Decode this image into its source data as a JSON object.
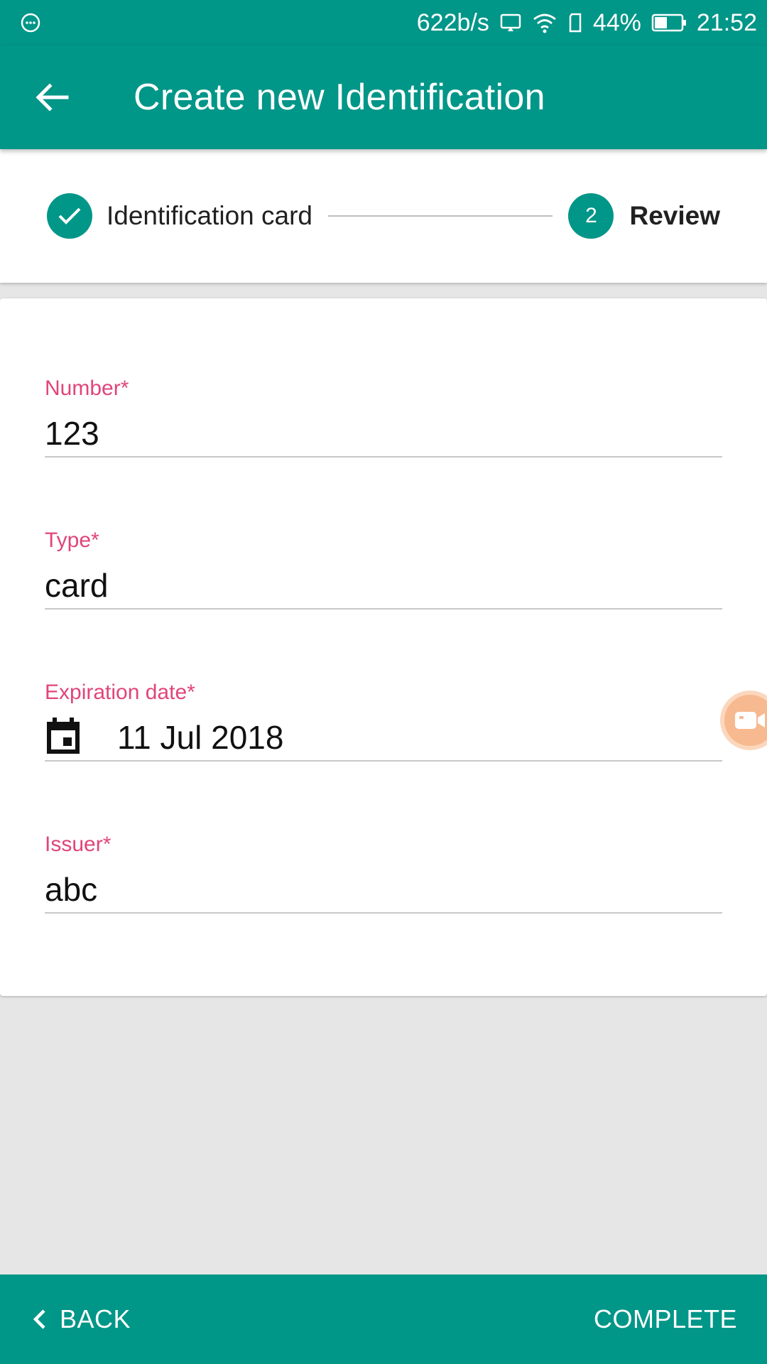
{
  "status_bar": {
    "speed": "622b/s",
    "battery": "44%",
    "time": "21:52"
  },
  "app_bar": {
    "title": "Create new Identification"
  },
  "stepper": {
    "step1_label": "Identification card",
    "step2_number": "2",
    "step2_label": "Review"
  },
  "form": {
    "number_label": "Number*",
    "number_value": "123",
    "type_label": "Type*",
    "type_value": "card",
    "expiration_label": "Expiration date*",
    "expiration_value": "11 Jul 2018",
    "issuer_label": "Issuer*",
    "issuer_value": "abc"
  },
  "bottom_bar": {
    "back_label": "BACK",
    "complete_label": "COMPLETE"
  },
  "colors": {
    "primary": "#009688",
    "label_accent": "#e0457b"
  }
}
